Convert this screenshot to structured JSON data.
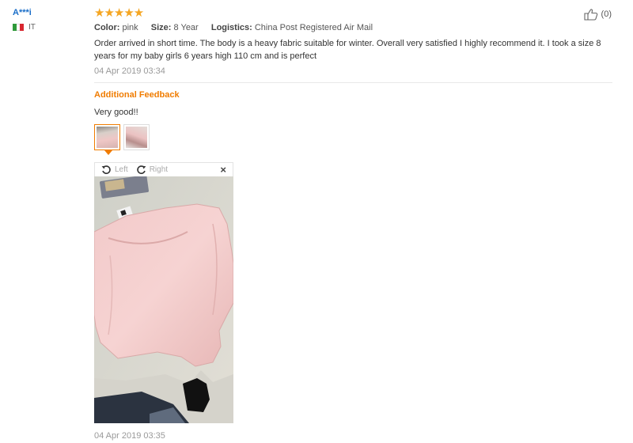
{
  "user": {
    "name": "A***i",
    "country": "IT",
    "flag_colors": [
      "#2f9a3a",
      "#ffffff",
      "#d8272f"
    ]
  },
  "review": {
    "stars": "★★★★★",
    "rating": 5,
    "color_label": "Color:",
    "color_value": "pink",
    "size_label": "Size:",
    "size_value": "8 Year",
    "logistics_label": "Logistics:",
    "logistics_value": "China Post Registered Air Mail",
    "text": "Order arrived in short time. The body is a heavy fabric suitable for winter. Overall very satisfied I highly recommend it. I took a size 8 years for my baby girls 6 years high 110 cm and is perfect",
    "date": "04 Apr 2019 03:34",
    "helpful_count": "(0)"
  },
  "additional": {
    "title": "Additional Feedback",
    "text": "Very good!!",
    "date": "04 Apr 2019 03:35",
    "thumbnail_count": 2,
    "active_thumbnail": 1
  },
  "viewer": {
    "rotate_left_label": "Left",
    "rotate_right_label": "Right",
    "close_label": "×"
  },
  "colors": {
    "accent": "#f07c00",
    "star": "#f5a623",
    "link": "#1a6ec8"
  }
}
